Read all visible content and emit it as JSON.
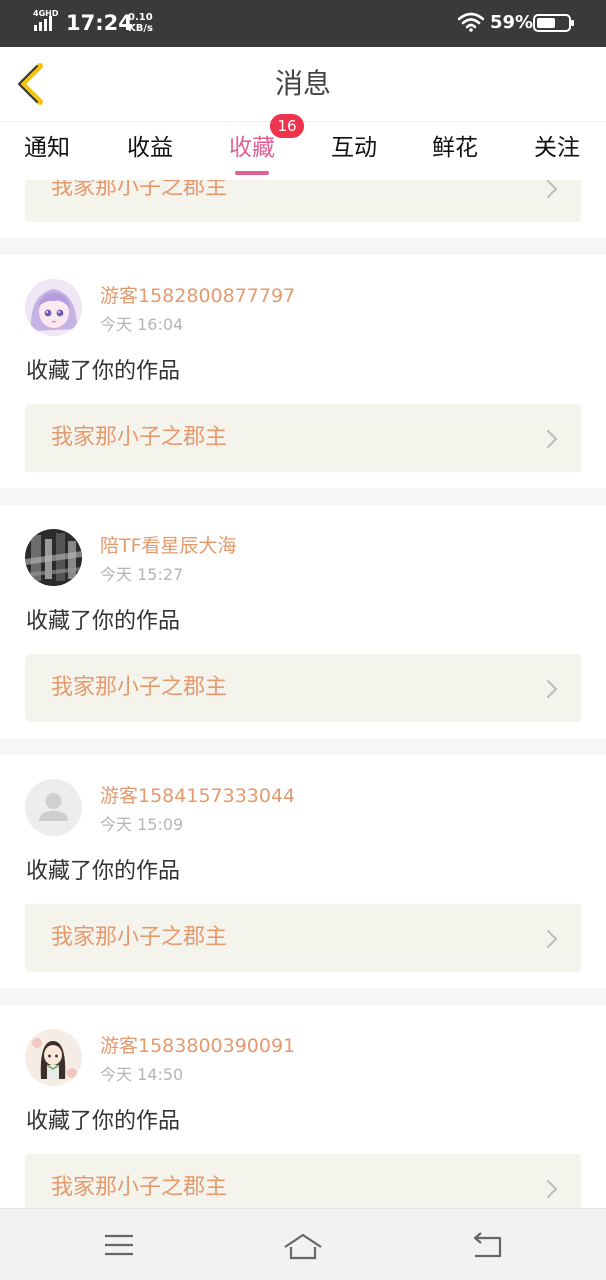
{
  "status_bar": {
    "network": "4GHD",
    "time": "17:24",
    "speed_value": "0.10",
    "speed_unit": "KB/s",
    "battery": "59%"
  },
  "header": {
    "title": "消息",
    "back_icon": "chevron-left-icon"
  },
  "tabs": [
    {
      "label": "通知"
    },
    {
      "label": "收益"
    },
    {
      "label": "收藏",
      "badge": "16",
      "active": true
    },
    {
      "label": "互动"
    },
    {
      "label": "鲜花"
    },
    {
      "label": "关注"
    }
  ],
  "partial_card": {
    "work_title": "我家那小子之郡主"
  },
  "cards": [
    {
      "name": "游客1582800877797",
      "time": "今天 16:04",
      "action": "收藏了你的作品",
      "work_title": "我家那小子之郡主",
      "avatar": "anime-girl-avatar"
    },
    {
      "name": "陪TF看星辰大海",
      "time": "今天 15:27",
      "action": "收藏了你的作品",
      "work_title": "我家那小子之郡主",
      "avatar": "photo-avatar"
    },
    {
      "name": "游客1584157333044",
      "time": "今天 15:09",
      "action": "收藏了你的作品",
      "work_title": "我家那小子之郡主",
      "avatar": "default-user-avatar"
    },
    {
      "name": "游客1583800390091",
      "time": "今天 14:50",
      "action": "收藏了你的作品",
      "work_title": "我家那小子之郡主",
      "avatar": "chibi-girl-avatar"
    }
  ],
  "colors": {
    "accent": "#e25f95",
    "badge": "#f0334d",
    "username": "#e59a6e",
    "work_bg": "#f5f4ec"
  },
  "nav": {
    "menu_icon": "menu-icon",
    "home_icon": "home-icon",
    "back_icon": "back-icon"
  }
}
